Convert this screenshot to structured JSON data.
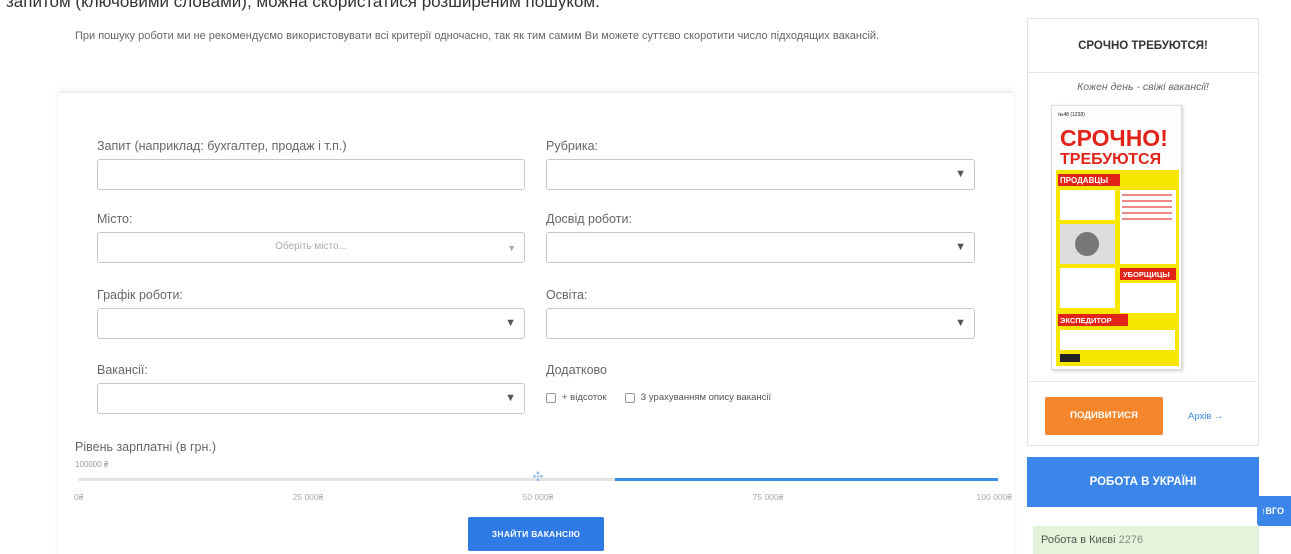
{
  "top_strip": "запитом (ключовими словами), можна скористатися розширеним пошуком.",
  "intro": "При пошуку роботи ми не рекомендуємо використовувати всі критерії одночасно, так як тим самим Ви можете суттєво скоротити число підходящих вакансій.",
  "form": {
    "query_label": "Запит (наприклад: бухгалтер, продаж і т.п.)",
    "query_value": "",
    "rubric_label": "Рубрика:",
    "city_label": "Місто:",
    "city_placeholder": "Оберіть місто...",
    "experience_label": "Досвід роботи:",
    "schedule_label": "Графік роботи:",
    "education_label": "Освіта:",
    "vacancies_label": "Вакансії:",
    "extra_label": "Додатково",
    "check_interest": "+ відсоток",
    "check_description": "З урахуванням опису вакансії"
  },
  "salary": {
    "label": "Рівень зарплатні (в грн.)",
    "value_text": "100000 ₴",
    "min": 0,
    "max": 100000,
    "handles": [
      50000,
      100000
    ],
    "ticks": [
      "0₴",
      "25 000₴",
      "50 000₴",
      "75 000₴",
      "100 000₴"
    ]
  },
  "find_button": "ЗНАЙТИ ВАКАНСІЮ",
  "promo": {
    "title": "СРОЧНО ТРЕБУЮТСЯ!",
    "subtitle": "Кожен день - свіжі вакансії!",
    "cover_title_1": "СРОЧНО!",
    "cover_title_2": "ТРЕБУЮТСЯ",
    "cover_section_1": "ПРОДАВЦЫ",
    "cover_section_2": "УБОРЩИЦЫ",
    "cover_section_3": "ЭКСПЕДИТОР",
    "look_button": "ПОДИВИТИСЯ",
    "archive_link": "Архів →"
  },
  "ukraine_button": "РОБОТА В УКРАЇНІ",
  "kyiv": {
    "label": "Робота в Києві",
    "count": "2276"
  },
  "side_tab": "↑ВГО",
  "colors": {
    "accent_blue": "#3b86e8",
    "orange": "#f5862b",
    "green_bg": "#e3f4da"
  }
}
